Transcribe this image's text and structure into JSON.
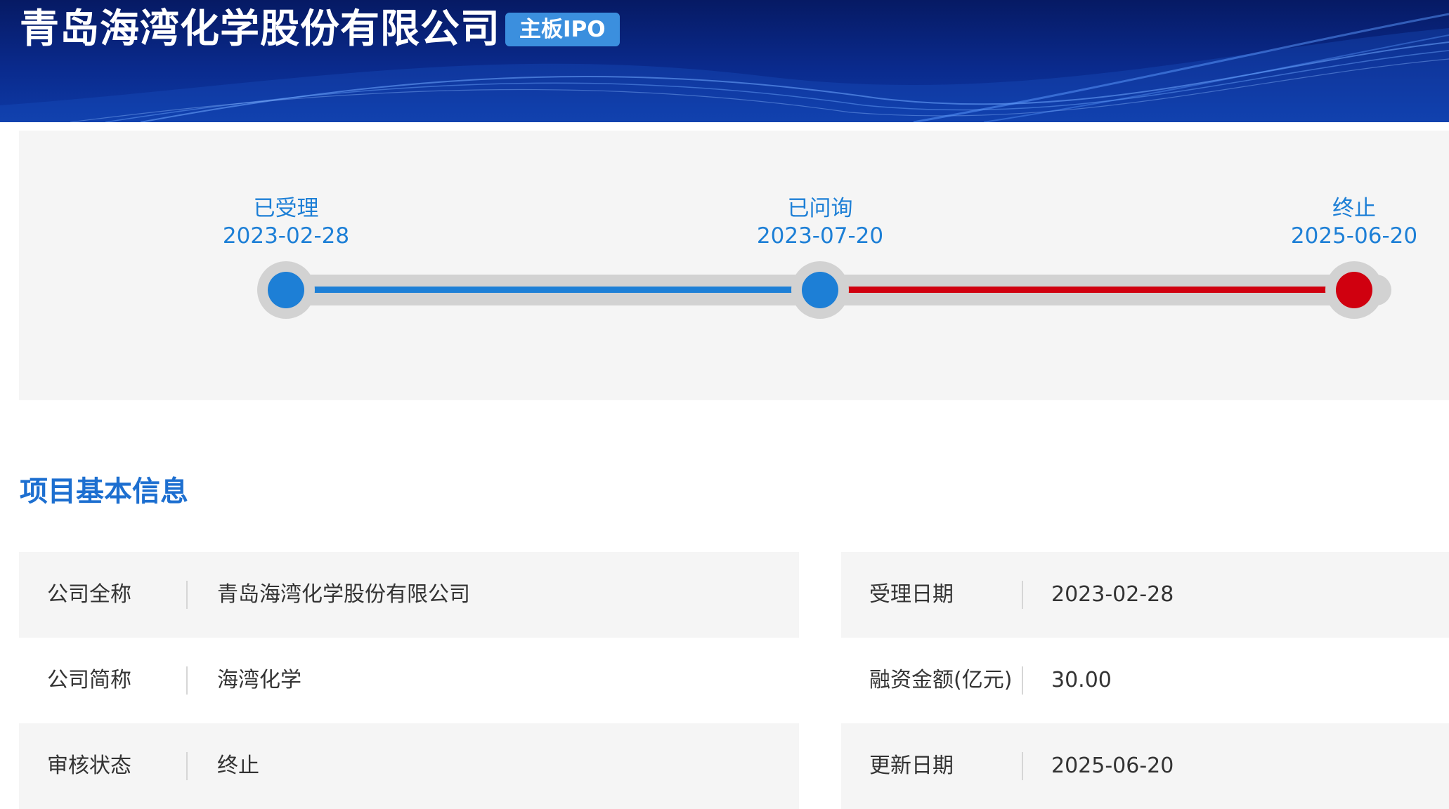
{
  "header": {
    "company_name": "青岛海湾化学股份有限公司",
    "board_badge": "主板IPO"
  },
  "colors": {
    "banner": "#0a2a8c",
    "accent_blue": "#1d7fd6",
    "terminated_red": "#d0000f",
    "track_gray": "#d2d2d2",
    "panel_bg": "#f5f5f5"
  },
  "timeline": {
    "stages": [
      {
        "name": "已受理",
        "date": "2023-02-28",
        "status": "completed"
      },
      {
        "name": "已问询",
        "date": "2023-07-20",
        "status": "completed"
      },
      {
        "name": "终止",
        "date": "2025-06-20",
        "status": "terminated"
      }
    ]
  },
  "basic_info": {
    "section_title": "项目基本信息",
    "left": [
      {
        "label": "公司全称",
        "value": "青岛海湾化学股份有限公司"
      },
      {
        "label": "公司简称",
        "value": "海湾化学"
      },
      {
        "label": "审核状态",
        "value": "终止"
      }
    ],
    "right": [
      {
        "label": "受理日期",
        "value": "2023-02-28"
      },
      {
        "label": "融资金额(亿元)",
        "value": "30.00"
      },
      {
        "label": "更新日期",
        "value": "2025-06-20"
      }
    ]
  }
}
